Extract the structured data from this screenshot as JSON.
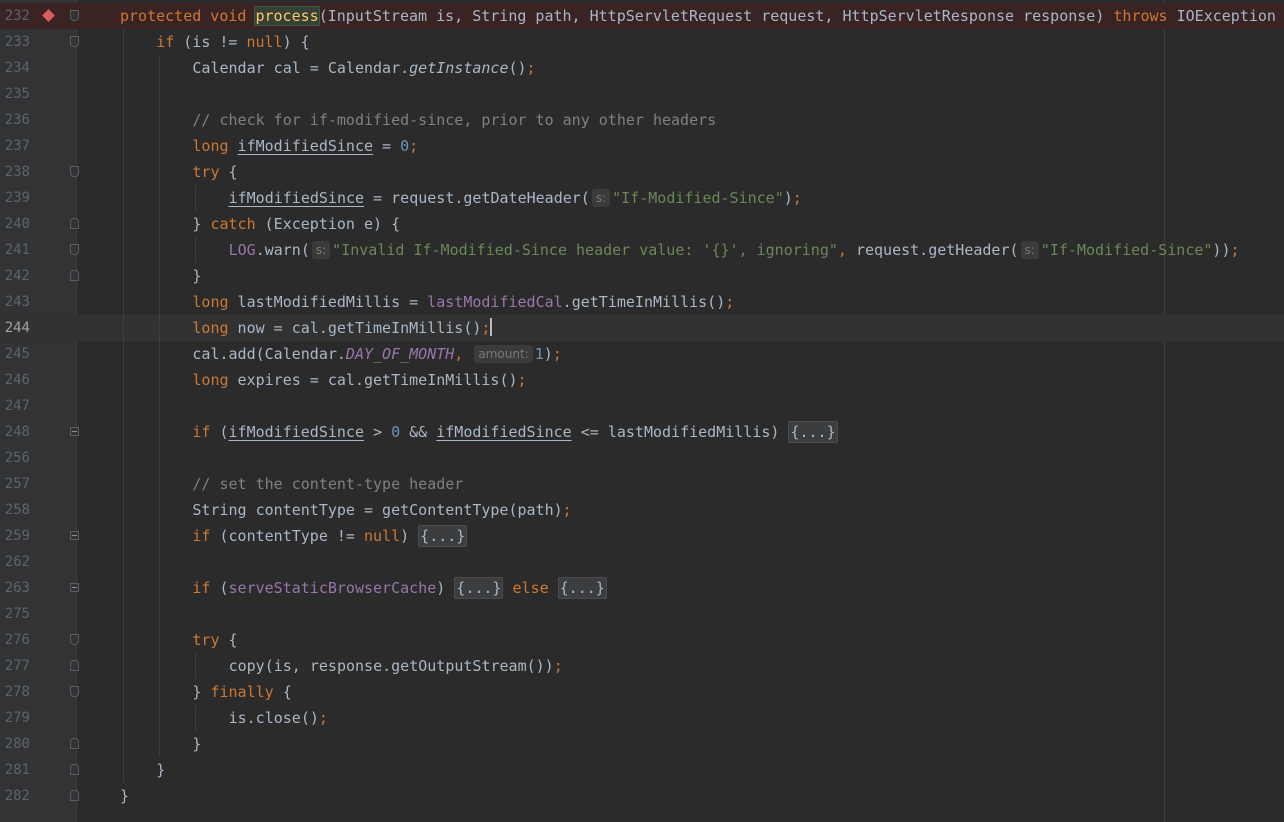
{
  "editor": {
    "language": "Java",
    "colors": {
      "background": "#2b2b2b",
      "keyword": "#cc7832",
      "string": "#6a8759",
      "number": "#6897bb",
      "comment": "#808080",
      "field": "#9876aa",
      "method_declaration": "#ffc66d",
      "breakpoint": "#db5c5c"
    },
    "breakpoint_line": "232",
    "caret_line": "244",
    "lines": [
      {
        "n": "232",
        "t": [
          [
            "kw",
            "protected void "
          ],
          [
            "mdecl",
            "process"
          ],
          [
            "p",
            "(InputStream is, String path, HttpServletRequest request, HttpServletResponse response) "
          ],
          [
            "kw",
            "throws"
          ],
          [
            "p",
            " IOException "
          ]
        ]
      },
      {
        "n": "233",
        "t": [
          [
            "kw",
            "if"
          ],
          [
            "p",
            " (is != "
          ],
          [
            "kw",
            "null"
          ],
          [
            "p",
            ") {"
          ]
        ]
      },
      {
        "n": "234",
        "t": [
          [
            "p",
            "Calendar cal = Calendar."
          ],
          [
            "sm",
            "getInstance"
          ],
          [
            "p",
            "()"
          ],
          [
            "kw",
            ";"
          ]
        ]
      },
      {
        "n": "235",
        "t": []
      },
      {
        "n": "236",
        "t": [
          [
            "cm",
            "// check for if-modified-since, prior to any other headers"
          ]
        ]
      },
      {
        "n": "237",
        "t": [
          [
            "kw",
            "long "
          ],
          [
            "ul",
            "ifModifiedSince"
          ],
          [
            "p",
            " = "
          ],
          [
            "num",
            "0"
          ],
          [
            "kw",
            ";"
          ]
        ]
      },
      {
        "n": "238",
        "t": [
          [
            "kw",
            "try"
          ],
          [
            "p",
            " {"
          ]
        ]
      },
      {
        "n": "239",
        "t": [
          [
            "ul",
            "ifModifiedSince"
          ],
          [
            "p",
            " = request.getDateHeader("
          ],
          [
            "hint",
            "s:"
          ],
          [
            "str",
            "\"If-Modified-Since\""
          ],
          [
            "p",
            ")"
          ],
          [
            "kw",
            ";"
          ]
        ]
      },
      {
        "n": "240",
        "t": [
          [
            "p",
            "} "
          ],
          [
            "kw",
            "catch"
          ],
          [
            "p",
            " (Exception e) {"
          ]
        ]
      },
      {
        "n": "241",
        "t": [
          [
            "fld",
            "LOG"
          ],
          [
            "p",
            ".warn("
          ],
          [
            "hint",
            "s:"
          ],
          [
            "str",
            "\"Invalid If-Modified-Since header value: '{}', ignoring\""
          ],
          [
            "kw",
            ","
          ],
          [
            "p",
            " request.getHeader("
          ],
          [
            "hint",
            "s:"
          ],
          [
            "str",
            "\"If-Modified-Since\""
          ],
          [
            "p",
            "))"
          ],
          [
            "kw",
            ";"
          ]
        ]
      },
      {
        "n": "242",
        "t": [
          [
            "p",
            "}"
          ]
        ]
      },
      {
        "n": "243",
        "t": [
          [
            "kw",
            "long "
          ],
          [
            "p",
            "lastModifiedMillis = "
          ],
          [
            "fld",
            "lastModifiedCal"
          ],
          [
            "p",
            ".getTimeInMillis()"
          ],
          [
            "kw",
            ";"
          ]
        ]
      },
      {
        "n": "244",
        "t": [
          [
            "kw",
            "long "
          ],
          [
            "p",
            "now = cal.getTimeInMillis()"
          ],
          [
            "kw",
            ";"
          ],
          [
            "caret",
            ""
          ]
        ]
      },
      {
        "n": "245",
        "t": [
          [
            "p",
            "cal.add(Calendar."
          ],
          [
            "sfld",
            "DAY_OF_MONTH"
          ],
          [
            "kw",
            ", "
          ],
          [
            "hint",
            "amount:"
          ],
          [
            "num",
            "1"
          ],
          [
            "p",
            ")"
          ],
          [
            "kw",
            ";"
          ]
        ]
      },
      {
        "n": "246",
        "t": [
          [
            "kw",
            "long "
          ],
          [
            "p",
            "expires = cal.getTimeInMillis()"
          ],
          [
            "kw",
            ";"
          ]
        ]
      },
      {
        "n": "247",
        "t": []
      },
      {
        "n": "248",
        "t": [
          [
            "kw",
            "if"
          ],
          [
            "p",
            " ("
          ],
          [
            "ul",
            "ifModifiedSince"
          ],
          [
            "p",
            " > "
          ],
          [
            "num",
            "0"
          ],
          [
            "p",
            " && "
          ],
          [
            "ul",
            "ifModifiedSince"
          ],
          [
            "p",
            " <= lastModifiedMillis) "
          ],
          [
            "fold",
            "{...}"
          ]
        ]
      },
      {
        "n": "256",
        "t": []
      },
      {
        "n": "257",
        "t": [
          [
            "cm",
            "// set the content-type header"
          ]
        ]
      },
      {
        "n": "258",
        "t": [
          [
            "p",
            "String contentType = getContentType(path)"
          ],
          [
            "kw",
            ";"
          ]
        ]
      },
      {
        "n": "259",
        "t": [
          [
            "kw",
            "if"
          ],
          [
            "p",
            " (contentType != "
          ],
          [
            "kw",
            "null"
          ],
          [
            "p",
            ") "
          ],
          [
            "fold",
            "{...}"
          ]
        ]
      },
      {
        "n": "262",
        "t": []
      },
      {
        "n": "263",
        "t": [
          [
            "kw",
            "if"
          ],
          [
            "p",
            " ("
          ],
          [
            "fld",
            "serveStaticBrowserCache"
          ],
          [
            "p",
            ") "
          ],
          [
            "fold",
            "{...}"
          ],
          [
            "p",
            " "
          ],
          [
            "kw",
            "else"
          ],
          [
            "p",
            " "
          ],
          [
            "fold",
            "{...}"
          ]
        ]
      },
      {
        "n": "275",
        "t": []
      },
      {
        "n": "276",
        "t": [
          [
            "kw",
            "try"
          ],
          [
            "p",
            " {"
          ]
        ]
      },
      {
        "n": "277",
        "t": [
          [
            "p",
            "copy(is, response.getOutputStream())"
          ],
          [
            "kw",
            ";"
          ]
        ]
      },
      {
        "n": "278",
        "t": [
          [
            "p",
            "} "
          ],
          [
            "kw",
            "finally"
          ],
          [
            "p",
            " {"
          ]
        ]
      },
      {
        "n": "279",
        "t": [
          [
            "p",
            "is.close()"
          ],
          [
            "kw",
            ";"
          ]
        ]
      },
      {
        "n": "280",
        "t": [
          [
            "p",
            "}"
          ]
        ]
      },
      {
        "n": "281",
        "t": [
          [
            "p",
            "}"
          ]
        ]
      },
      {
        "n": "282",
        "t": [
          [
            "p",
            "}"
          ]
        ]
      }
    ]
  }
}
